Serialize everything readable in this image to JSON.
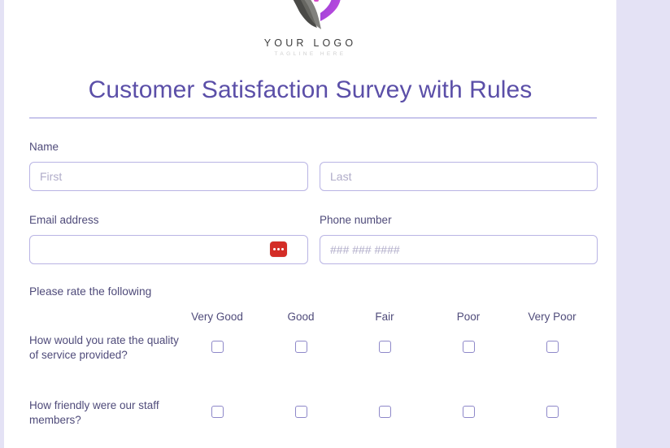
{
  "page": {
    "background_color": "#e4e2f5",
    "card_background_color": "#ffffff",
    "accent_color": "#5b4fa8",
    "border_color": "#b9b4e4"
  },
  "logo": {
    "icon": "brand-logo-mark",
    "wordmark": "YOUR LOGO",
    "tagline": "TAGLINE HERE"
  },
  "header": {
    "title": "Customer Satisfaction Survey with Rules"
  },
  "fields": {
    "name": {
      "label": "Name",
      "first": {
        "placeholder": "First",
        "value": ""
      },
      "last": {
        "placeholder": "Last",
        "value": ""
      }
    },
    "email": {
      "label": "Email address",
      "placeholder": "",
      "value": "",
      "autofill_icon": "lastpass-autofill-icon",
      "autofill_icon_color": "#d32d27"
    },
    "phone": {
      "label": "Phone number",
      "placeholder": "### ### ####",
      "value": ""
    }
  },
  "rating": {
    "prompt": "Please rate the following",
    "columns": [
      "Very Good",
      "Good",
      "Fair",
      "Poor",
      "Very Poor"
    ],
    "questions": [
      {
        "text": "How would you rate the quality of service provided?",
        "answers": [
          false,
          false,
          false,
          false,
          false
        ]
      },
      {
        "text": "How friendly were our staff members?",
        "answers": [
          false,
          false,
          false,
          false,
          false
        ]
      }
    ]
  }
}
